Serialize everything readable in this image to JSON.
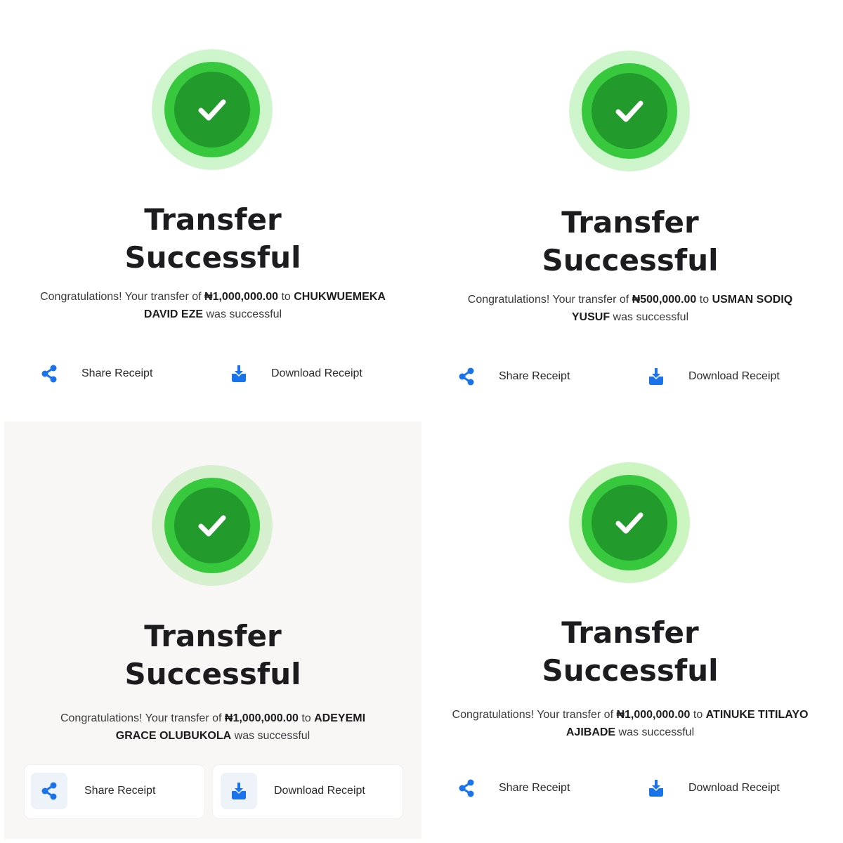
{
  "colors": {
    "success_outer": "#cdf5cb",
    "success_mid": "#37c83e",
    "success_inner": "#229a2c",
    "action_icon": "#1a73e8"
  },
  "icons": {
    "status": "checkmark-icon",
    "share": "share-icon",
    "download": "download-icon"
  },
  "panels": [
    {
      "title_line1": "Transfer",
      "title_line2": "Successful",
      "msg_prefix": "Congratulations! Your transfer of ",
      "amount": "₦1,000,000.00",
      "msg_to": " to ",
      "recipient": "CHUKWUEMEKA DAVID EZE",
      "msg_suffix": " was successful",
      "share_label": "Share Receipt",
      "download_label": "Download Receipt"
    },
    {
      "title_line1": "Transfer",
      "title_line2": "Successful",
      "msg_prefix": "Congratulations! Your transfer of ",
      "amount": "₦500,000.00",
      "msg_to": " to ",
      "recipient": "USMAN SODIQ YUSUF",
      "msg_suffix": " was successful",
      "share_label": "Share Receipt",
      "download_label": "Download Receipt"
    },
    {
      "title_line1": "Transfer",
      "title_line2": "Successful",
      "msg_prefix": "Congratulations! Your transfer of ",
      "amount": "₦1,000,000.00",
      "msg_to": " to ",
      "recipient": "ADEYEMI GRACE OLUBUKOLA",
      "msg_suffix": " was successful",
      "share_label": "Share Receipt",
      "download_label": "Download Receipt"
    },
    {
      "title_line1": "Transfer",
      "title_line2": "Successful",
      "msg_prefix": "Congratulations! Your transfer of ",
      "amount": "₦1,000,000.00",
      "msg_to": " to ",
      "recipient": "ATINUKE TITILAYO AJIBADE",
      "msg_suffix": " was successful",
      "share_label": "Share Receipt",
      "download_label": "Download Receipt"
    }
  ]
}
